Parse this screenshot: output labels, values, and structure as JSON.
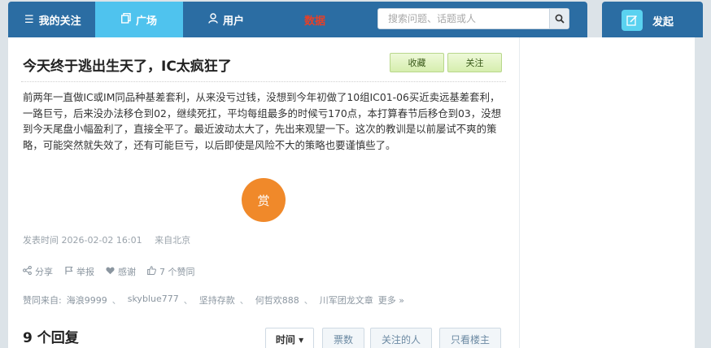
{
  "nav": {
    "following": "我的关注",
    "plaza": "广场",
    "users": "用户",
    "data": "数据"
  },
  "search": {
    "placeholder": "搜索问题、话题或人"
  },
  "post_button": "发起",
  "post": {
    "title": "今天终于逃出生天了，IC太疯狂了",
    "favorite_label": "收藏",
    "follow_label": "关注",
    "body": "前两年一直做IC或IM同品种基差套利，从来没亏过钱，没想到今年初做了10组IC01-06买近卖远基差套利，一路巨亏，后来没办法移仓到02，继续死扛，平均每组最多的时候亏170点，本打算春节后移仓到03，没想到今天尾盘小幅盈利了，直接全平了。最近波动太大了，先出来观望一下。这次的教训是以前屡试不爽的策略，可能突然就失效了，还有可能巨亏，以后即使是风险不大的策略也要谨慎些了。",
    "reward_label": "赏",
    "published": "发表时间 2026-02-02 16:01",
    "location": "来自北京"
  },
  "actions": {
    "share": "分享",
    "report": "举报",
    "thanks": "感谢",
    "likes": "7 个赞同"
  },
  "likers": {
    "label": "赞同来自:",
    "users": [
      "海浪9999",
      "skyblue777",
      "坚持存款",
      "何哲欢888",
      "川军团龙文章"
    ],
    "more": "更多 »"
  },
  "replies": {
    "count_label": "9 个回复",
    "sort_time": "时间 ▾",
    "sort_votes": "票数",
    "sort_followers": "关注的人",
    "sort_op": "只看楼主"
  },
  "colors": {
    "nav_bg": "#2b6da3",
    "nav_active": "#4fc3ee",
    "data_red": "#e64028",
    "reward": "#f0892a"
  }
}
